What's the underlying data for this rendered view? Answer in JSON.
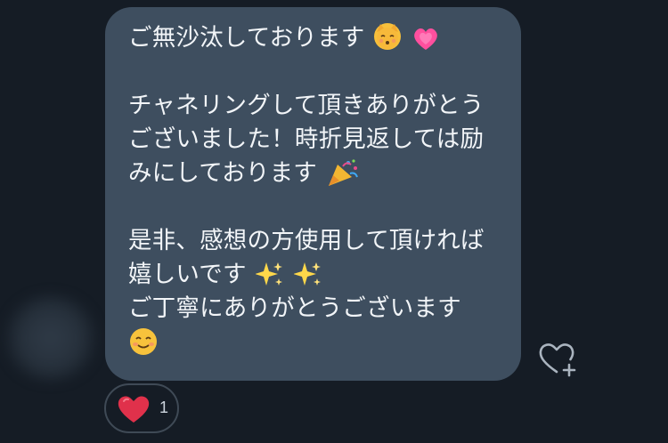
{
  "message": {
    "lines": [
      {
        "text": "ご無沙汰しております",
        "emoji": [
          "kissing-cat-icon",
          "growing-heart-icon"
        ]
      },
      {
        "text": "",
        "emoji": []
      },
      {
        "text": "チャネリングして頂きありがとう",
        "emoji": []
      },
      {
        "text": "ございました！時折見返しては励",
        "emoji": []
      },
      {
        "text": "みにしております",
        "emoji": [
          "party-popper-icon"
        ]
      },
      {
        "text": "",
        "emoji": []
      },
      {
        "text": "是非、感想の方使用して頂ければ",
        "emoji": []
      },
      {
        "text": "嬉しいです",
        "emoji": [
          "sparkles-icon",
          "sparkles-icon"
        ]
      },
      {
        "text": "ご丁寧にありがとうございます",
        "emoji": []
      },
      {
        "text": "",
        "emoji": [
          "smiling-face-icon"
        ]
      }
    ]
  },
  "reaction": {
    "icon": "red-heart-icon",
    "count": "1"
  },
  "actions": {
    "add_reaction_icon": "heart-plus-icon"
  },
  "colors": {
    "background": "#151c25",
    "bubble": "#3e4e5f",
    "text": "#f2f5f8",
    "heart": "#e0314b"
  }
}
